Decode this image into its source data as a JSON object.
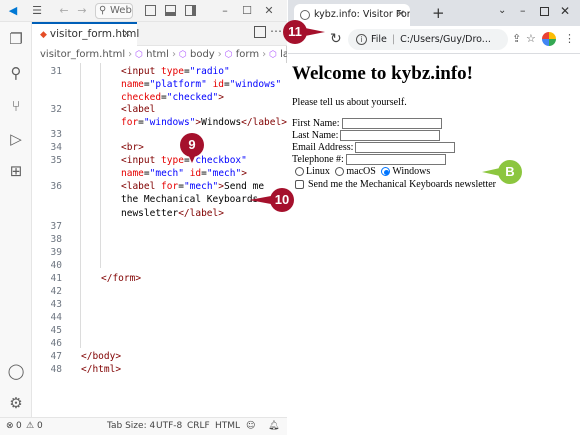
{
  "vscode": {
    "search_text": "Web...",
    "tab_label": "visitor_form.html",
    "breadcrumb": [
      "visitor_form.html",
      "html",
      "body",
      "form",
      "label"
    ],
    "status": {
      "errors": "0",
      "warnings": "0",
      "tab_size": "Tab Size: 4",
      "encoding": "UTF-8",
      "eol": "CRLF",
      "language": "HTML"
    },
    "line_numbers": [
      "31",
      "32",
      "33",
      "34",
      "35",
      "36",
      "37",
      "38",
      "39",
      "40",
      "41",
      "42",
      "43",
      "44",
      "45",
      "46",
      "47",
      "48"
    ]
  },
  "browser": {
    "tab_title": "kybz.info: Visitor Form",
    "address_prefix": "File",
    "address": "C:/Users/Guy/Dro...",
    "page_heading": "Welcome to kybz.info!",
    "intro": "Please tell us about yourself.",
    "fields": [
      "First Name:",
      "Last Name:",
      "Email Address:",
      "Telephone #:"
    ],
    "platform_options": [
      "Linux",
      "macOS",
      "Windows"
    ],
    "platform_selected": "Windows",
    "newsletter_label": "Send me the Mechanical Keyboards newsletter"
  },
  "callouts": {
    "c9": "9",
    "c10": "10",
    "c11": "11",
    "cB": "B"
  },
  "colors": {
    "callout_red": "#a5102c",
    "callout_green": "#8cc63f",
    "vscode_accent": "#005fb8",
    "radio_accent": "#0075ff"
  }
}
